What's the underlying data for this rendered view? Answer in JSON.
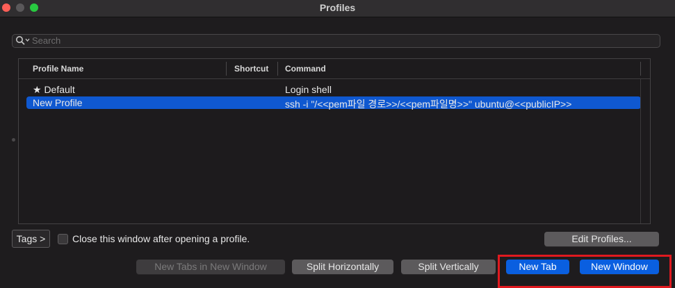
{
  "window": {
    "title": "Profiles"
  },
  "search": {
    "placeholder": "Search",
    "value": ""
  },
  "table": {
    "columns": [
      "Profile Name",
      "Shortcut",
      "Command"
    ],
    "rows": [
      {
        "name": "★ Default",
        "shortcut": "",
        "command": "Login shell",
        "selected": false
      },
      {
        "name": "New Profile",
        "shortcut": "",
        "command": "ssh -i \"/<<pem파일 경로>>/<<pem파일명>>\" ubuntu@<<publicIP>>",
        "selected": true
      }
    ]
  },
  "tags_button": {
    "label": "Tags >"
  },
  "close_checkbox": {
    "label": "Close this window after opening a profile.",
    "checked": false
  },
  "edit_profiles_button": {
    "label": "Edit Profiles..."
  },
  "actions": {
    "new_tabs_in_new_window": "New Tabs in New Window",
    "split_horizontally": "Split Horizontally",
    "split_vertically": "Split Vertically",
    "new_tab": "New Tab",
    "new_window": "New Window"
  },
  "colors": {
    "selection": "#0f58d0",
    "primary_button": "#0a5fe0",
    "highlight_box": "#e0191f"
  }
}
